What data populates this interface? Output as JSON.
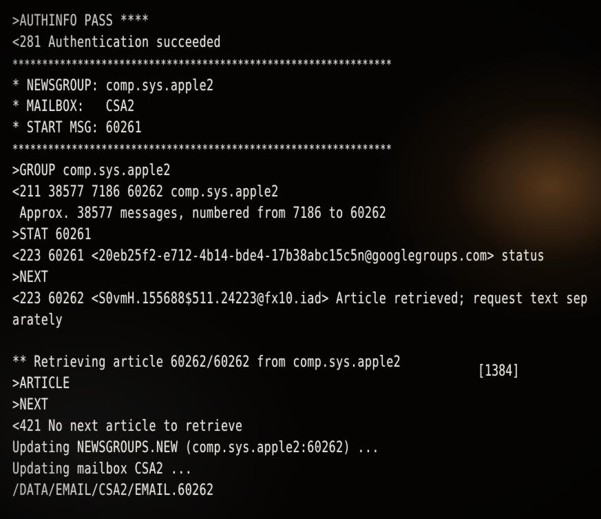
{
  "terminal": {
    "lines": [
      ">AUTHINFO PASS ****",
      "<281 Authentication succeeded",
      "****************************************************************",
      "* NEWSGROUP: comp.sys.apple2",
      "* MAILBOX:   CSA2",
      "* START MSG: 60261",
      "****************************************************************",
      ">GROUP comp.sys.apple2",
      "<211 38577 7186 60262 comp.sys.apple2",
      " Approx. 38577 messages, numbered from 7186 to 60262",
      ">STAT 60261",
      "<223 60261 <20eb25f2-e712-4b14-bde4-17b38abc15c5n@googlegroups.com> status",
      ">NEXT",
      "<223 60262 <S0vmH.155688$511.24223@fx10.iad> Article retrieved; request text sep",
      "arately",
      "",
      "** Retrieving article 60262/60262 from comp.sys.apple2",
      ">ARTICLE",
      ">NEXT",
      "<421 No next article to retrieve",
      "Updating NEWSGROUPS.NEW (comp.sys.apple2:60262) ...",
      "Updating mailbox CSA2 ...",
      "/DATA/EMAIL/CSA2/EMAIL.60262"
    ],
    "article_status": "[1384]"
  }
}
